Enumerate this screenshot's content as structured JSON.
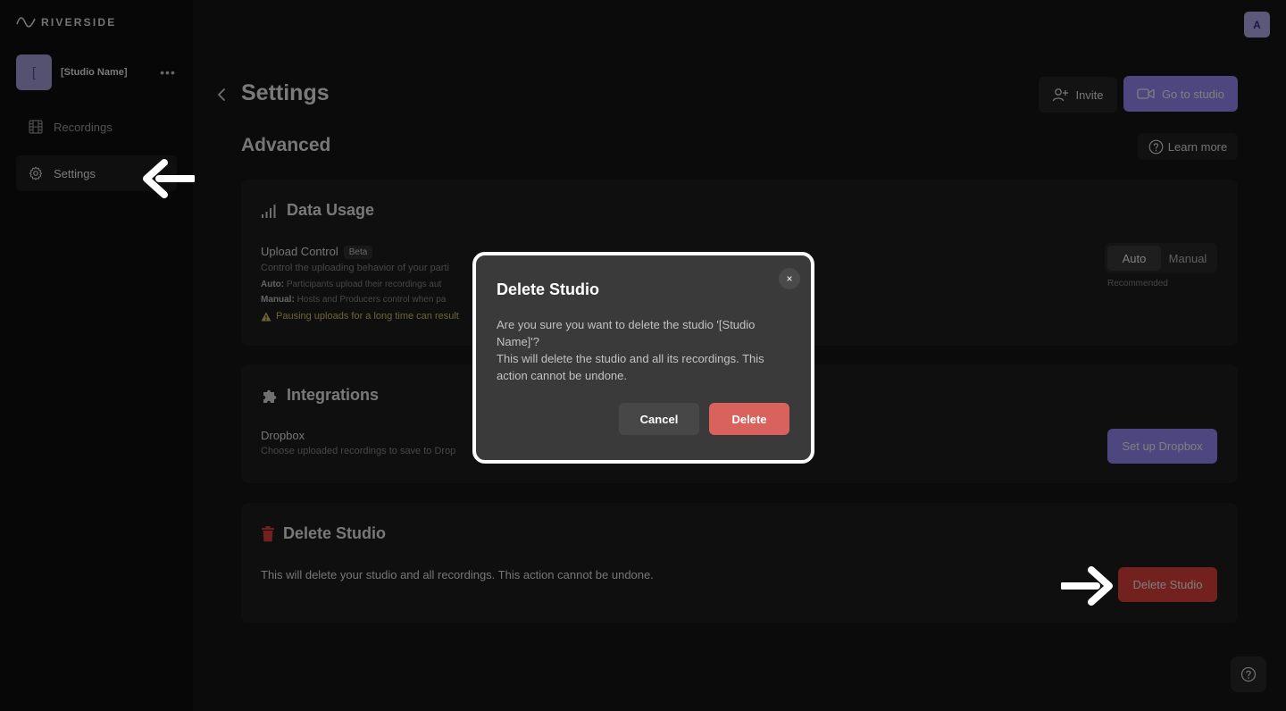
{
  "app": {
    "logo_text": "RIVERSIDE",
    "studio_initial": "[",
    "studio_name": "[Studio Name]",
    "user_initial": "A"
  },
  "sidebar": {
    "items": [
      {
        "label": "Recordings",
        "icon": "film-icon"
      },
      {
        "label": "Settings",
        "icon": "gear-icon"
      }
    ]
  },
  "header": {
    "title": "Settings",
    "invite_label": "Invite",
    "go_to_studio_label": "Go to studio",
    "section_title": "Advanced",
    "learn_more_label": "Learn more"
  },
  "data_usage": {
    "title": "Data Usage",
    "upload_control_label": "Upload Control",
    "beta_badge": "Beta",
    "description": "Control the uploading behavior of your parti",
    "auto_label": "Auto:",
    "auto_text": "Participants upload their recordings aut",
    "manual_label": "Manual:",
    "manual_text": "Hosts and Producers control when pa",
    "warning": "Pausing uploads for a long time can result",
    "toggle_auto": "Auto",
    "toggle_manual": "Manual",
    "toggle_selected": "Auto",
    "recommended": "Recommended"
  },
  "integrations": {
    "title": "Integrations",
    "dropbox_label": "Dropbox",
    "dropbox_desc": "Choose uploaded recordings to save to Drop",
    "setup_button": "Set up Dropbox"
  },
  "delete_section": {
    "title": "Delete Studio",
    "description": "This will delete your studio and all recordings. This action cannot be undone.",
    "button": "Delete Studio"
  },
  "modal": {
    "title": "Delete Studio",
    "line1": "Are you sure you want to delete the studio '[Studio Name]'?",
    "line2": "This will delete the studio and all its recordings. This action cannot be undone.",
    "cancel": "Cancel",
    "delete": "Delete",
    "close": "×"
  },
  "colors": {
    "accent": "#9b8cff",
    "danger": "#e4423f",
    "modal_danger": "#d9625c"
  }
}
